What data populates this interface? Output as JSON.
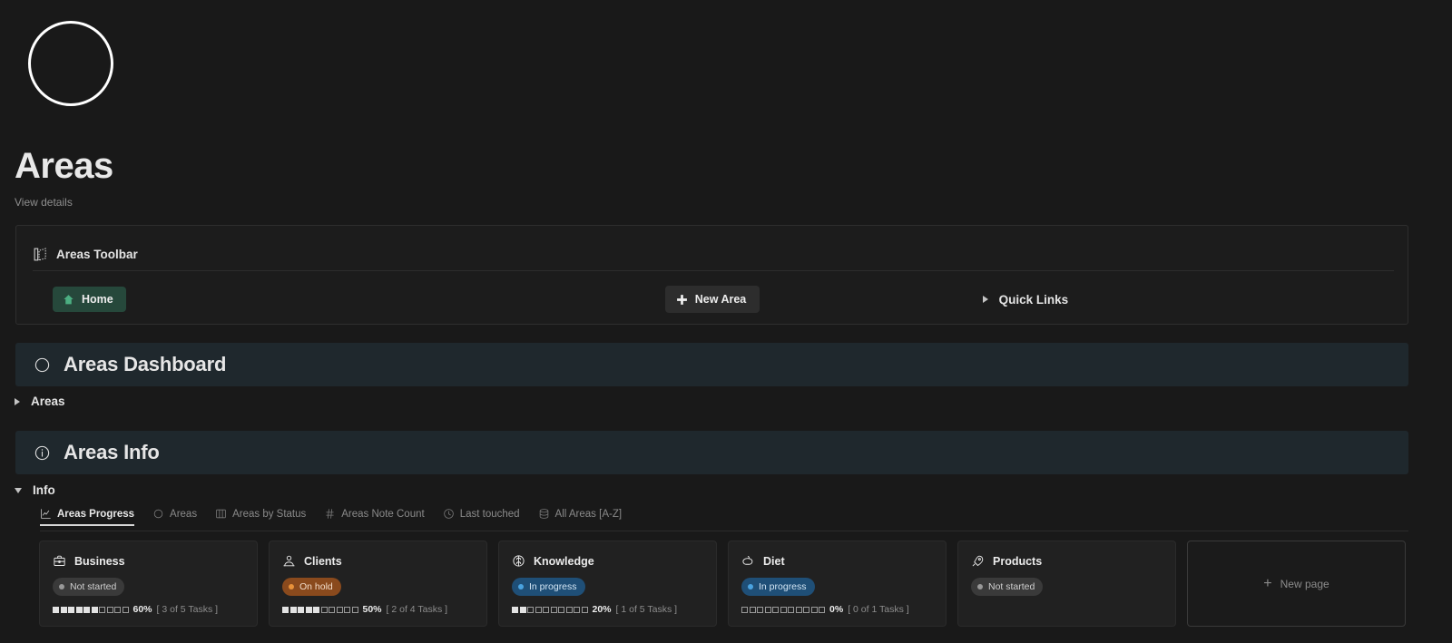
{
  "page": {
    "icon": "circle-outline-icon",
    "title": "Areas",
    "subtitle": "View details"
  },
  "toolbar": {
    "icon": "banner-flag-icon",
    "label": "Areas Toolbar",
    "home_button": {
      "icon": "home-icon",
      "label": "Home"
    },
    "new_area_button": {
      "icon": "plus-icon",
      "label": "New Area"
    },
    "quick_links": {
      "icon": "triangle-right-icon",
      "label": "Quick Links"
    }
  },
  "dashboard_section": {
    "icon": "circle-icon",
    "title": "Areas Dashboard",
    "toggle": {
      "icon": "triangle-right-icon",
      "label": "Areas"
    }
  },
  "info_section": {
    "icon": "info-circle-icon",
    "title": "Areas Info",
    "toggle": {
      "icon": "triangle-down-icon",
      "label": "Info"
    }
  },
  "tabs": [
    {
      "label": "Areas Progress",
      "icon": "chart-line-icon",
      "active": true
    },
    {
      "label": "Areas",
      "icon": "circle-icon",
      "active": false
    },
    {
      "label": "Areas by Status",
      "icon": "board-icon",
      "active": false
    },
    {
      "label": "Areas Note Count",
      "icon": "hash-icon",
      "active": false
    },
    {
      "label": "Last touched",
      "icon": "clock-icon",
      "active": false
    },
    {
      "label": "All Areas [A-Z]",
      "icon": "database-icon",
      "active": false
    }
  ],
  "cards": [
    {
      "title": "Business",
      "icon": "briefcase-icon",
      "status": "Not started",
      "status_color": "grey",
      "percent": "60%",
      "filled": 6,
      "empty": 4,
      "tasks": "[ 3 of 5 Tasks ]",
      "has_progress": true
    },
    {
      "title": "Clients",
      "icon": "person-icon",
      "status": "On hold",
      "status_color": "orange",
      "percent": "50%",
      "filled": 5,
      "empty": 5,
      "tasks": "[ 2 of 4 Tasks ]",
      "has_progress": true
    },
    {
      "title": "Knowledge",
      "icon": "brain-icon",
      "status": "In progress",
      "status_color": "blue",
      "percent": "20%",
      "filled": 2,
      "empty": 8,
      "tasks": "[ 1 of 5 Tasks ]",
      "has_progress": true
    },
    {
      "title": "Diet",
      "icon": "food-icon",
      "status": "In progress",
      "status_color": "blue",
      "percent": "0%",
      "filled": 0,
      "empty": 11,
      "tasks": "[ 0 of 1 Tasks ]",
      "has_progress": true
    },
    {
      "title": "Products",
      "icon": "rocket-icon",
      "status": "Not started",
      "status_color": "grey",
      "percent": "",
      "filled": 0,
      "empty": 0,
      "tasks": "",
      "has_progress": false
    }
  ],
  "new_page_card": {
    "icon": "plus-icon",
    "label": "New page"
  },
  "colors": {
    "background": "#191919",
    "callout_background": "#1f282d",
    "card_background": "#212121",
    "home_button_green": "#26483b",
    "accent_green": "#4caf82",
    "status_orange": "#e8923a",
    "status_blue": "#4aa3e0",
    "status_grey": "#989898"
  }
}
